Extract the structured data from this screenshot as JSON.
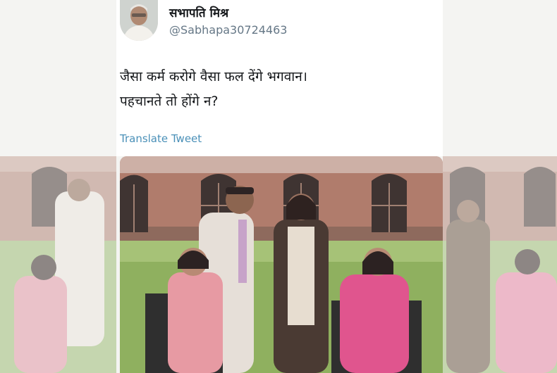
{
  "tweet": {
    "display_name": "सभापति मिश्र",
    "handle": "@Sabhapa30724463",
    "text_lines": [
      "जैसा कर्म करोगे वैसा फल देंगे भगवान।",
      "पहचानते तो होंगे न?"
    ],
    "translate_label": "Translate Tweet"
  },
  "colors": {
    "link": "#4a90b8",
    "handle": "#657786",
    "text": "#14171a"
  },
  "icons": {
    "avatar": "avatar-photo"
  }
}
